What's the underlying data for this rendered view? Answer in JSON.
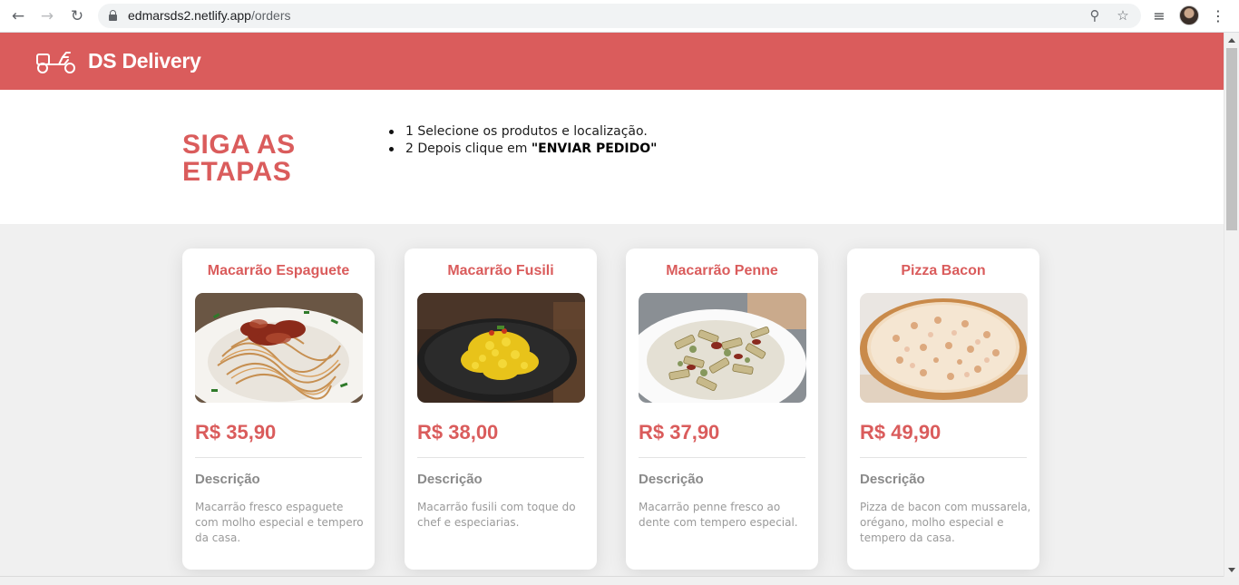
{
  "browser": {
    "url_host": "edmarsds2.netlify.app",
    "url_path": "/orders",
    "back_icon": "←",
    "forward_icon": "→",
    "reload_icon": "↻",
    "zoom_icon": "⚲",
    "star_icon": "☆",
    "media_icon": "≡",
    "menu_icon": "⋮"
  },
  "navbar": {
    "brand": "DS Delivery",
    "color": "#da5c5c"
  },
  "steps": {
    "title": "SIGA AS ETAPAS",
    "items": [
      {
        "text": "1 Selecione os produtos e localização.",
        "bold": ""
      },
      {
        "text": "2 Depois clique em ",
        "bold": "\"ENVIAR PEDIDO\""
      }
    ]
  },
  "products": [
    {
      "name": "Macarrão Espaguete",
      "price": "R$ 35,90",
      "description_label": "Descrição",
      "description": "Macarrão fresco espaguete com molho especial e tempero da casa."
    },
    {
      "name": "Macarrão Fusili",
      "price": "R$ 38,00",
      "description_label": "Descrição",
      "description": "Macarrão fusili com toque do chef e especiarias."
    },
    {
      "name": "Macarrão Penne",
      "price": "R$ 37,90",
      "description_label": "Descrição",
      "description": "Macarrão penne fresco ao dente com tempero especial."
    },
    {
      "name": "Pizza Bacon",
      "price": "R$ 49,90",
      "description_label": "Descrição",
      "description": "Pizza de bacon com mussarela, orégano, molho especial e tempero da casa."
    }
  ]
}
